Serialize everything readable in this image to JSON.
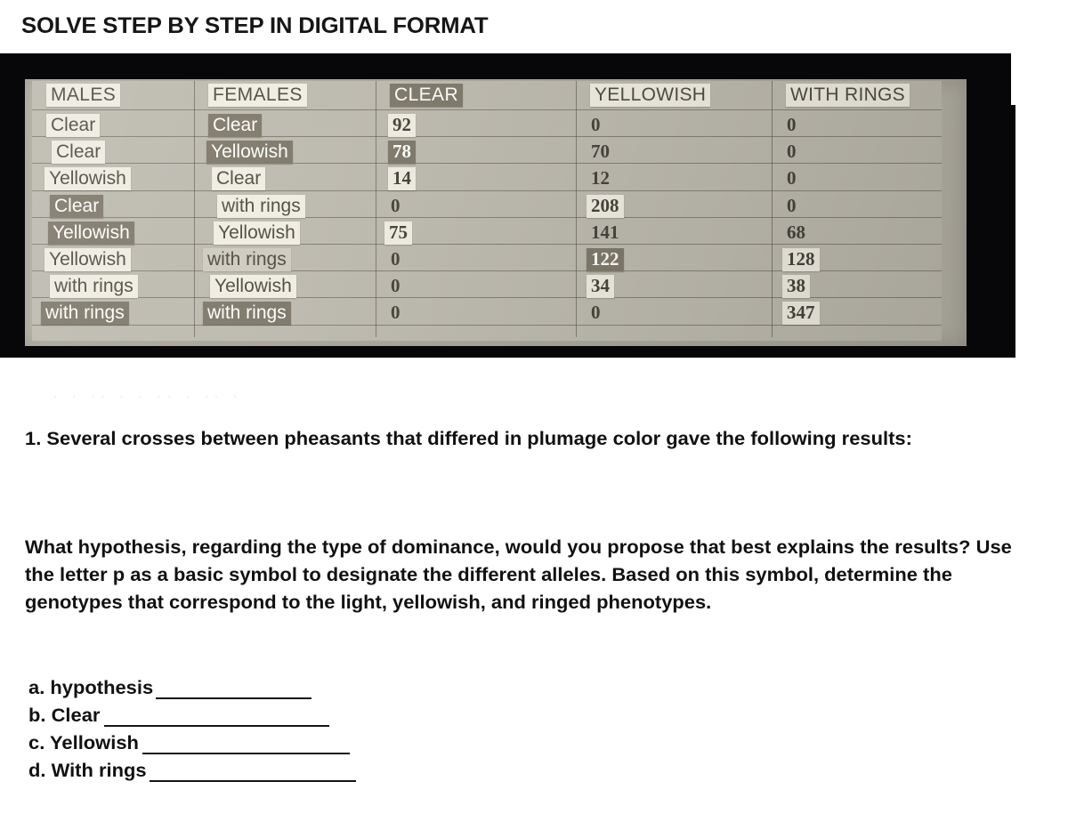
{
  "page_title": "SOLVE STEP BY STEP IN DIGITAL FORMAT",
  "ghost_text": "· ·   ··   · ·    ·· ·  ·· ·",
  "table": {
    "headers": [
      {
        "label": "MALES",
        "style": "hl-light",
        "kind": "txt"
      },
      {
        "label": "FEMALES",
        "style": "hl-light",
        "kind": "txt"
      },
      {
        "label": "CLEAR",
        "style": "hl-dark",
        "kind": "txt"
      },
      {
        "label": "YELLOWISH",
        "style": "hl-light",
        "kind": "num"
      },
      {
        "label": "WITH RINGS",
        "style": "hl-light",
        "kind": "num"
      }
    ],
    "rows": [
      {
        "males": {
          "value": "Clear",
          "style": "hl-light"
        },
        "females": {
          "value": "Clear",
          "style": "hl-dark"
        },
        "clear": {
          "value": "92",
          "style": "hl-light"
        },
        "yellowish": {
          "value": "0",
          "style": "hl-none"
        },
        "with_rings": {
          "value": "0",
          "style": "hl-none"
        }
      },
      {
        "males": {
          "value": "Clear",
          "style": "hl-light"
        },
        "females": {
          "value": "Yellowish",
          "style": "hl-dark"
        },
        "clear": {
          "value": "78",
          "style": "hl-dark"
        },
        "yellowish": {
          "value": "70",
          "style": "hl-none"
        },
        "with_rings": {
          "value": "0",
          "style": "hl-none"
        }
      },
      {
        "males": {
          "value": "Yellowish",
          "style": "hl-light"
        },
        "females": {
          "value": "Clear",
          "style": "hl-light"
        },
        "clear": {
          "value": "14",
          "style": "hl-light"
        },
        "yellowish": {
          "value": "12",
          "style": "hl-none"
        },
        "with_rings": {
          "value": "0",
          "style": "hl-none"
        }
      },
      {
        "males": {
          "value": "Clear",
          "style": "hl-dark"
        },
        "females": {
          "value": "with rings",
          "style": "hl-light"
        },
        "clear": {
          "value": "0",
          "style": "hl-none"
        },
        "yellowish": {
          "value": "208",
          "style": "hl-light"
        },
        "with_rings": {
          "value": "0",
          "style": "hl-none"
        }
      },
      {
        "males": {
          "value": "Yellowish",
          "style": "hl-dark"
        },
        "females": {
          "value": "Yellowish",
          "style": "hl-light"
        },
        "clear": {
          "value": "75",
          "style": "hl-light"
        },
        "yellowish": {
          "value": "141",
          "style": "hl-none"
        },
        "with_rings": {
          "value": "68",
          "style": "hl-none"
        }
      },
      {
        "males": {
          "value": "Yellowish",
          "style": "hl-light"
        },
        "females": {
          "value": "with rings",
          "style": "hl-mid"
        },
        "clear": {
          "value": "0",
          "style": "hl-none"
        },
        "yellowish": {
          "value": "122",
          "style": "hl-dark"
        },
        "with_rings": {
          "value": "128",
          "style": "hl-light"
        }
      },
      {
        "males": {
          "value": "with rings",
          "style": "hl-light"
        },
        "females": {
          "value": "Yellowish",
          "style": "hl-light"
        },
        "clear": {
          "value": "0",
          "style": "hl-none"
        },
        "yellowish": {
          "value": "34",
          "style": "hl-light"
        },
        "with_rings": {
          "value": "38",
          "style": "hl-light"
        }
      },
      {
        "males": {
          "value": "with rings",
          "style": "hl-dark"
        },
        "females": {
          "value": "with rings",
          "style": "hl-dark"
        },
        "clear": {
          "value": "0",
          "style": "hl-none"
        },
        "yellowish": {
          "value": "0",
          "style": "hl-none"
        },
        "with_rings": {
          "value": "347",
          "style": "hl-light"
        }
      }
    ]
  },
  "question": {
    "number_text": "1. Several crosses between pheasants that differed in plumage color gave the following results:",
    "body_text": "What hypothesis, regarding the type of dominance, would you propose that best explains the results? Use the letter p as a basic symbol to designate the different alleles. Based on this symbol, determine the genotypes that correspond to the light, yellowish, and ringed phenotypes.",
    "answers": [
      {
        "label": "a.  hypothesis",
        "blank_width": 175
      },
      {
        "label": "b. Clear",
        "blank_width": 253
      },
      {
        "label": "c. Yellowish",
        "blank_width": 233
      },
      {
        "label": "d. With rings",
        "blank_width": 232
      }
    ]
  },
  "colors": {
    "frame": "#07070a",
    "paper": "#bcb9ae",
    "highlight_light": "#efece1",
    "highlight_mid": "#cecabe",
    "highlight_dark": "#7d7869",
    "text_table": "#4e4b42",
    "text_body": "#111111"
  }
}
